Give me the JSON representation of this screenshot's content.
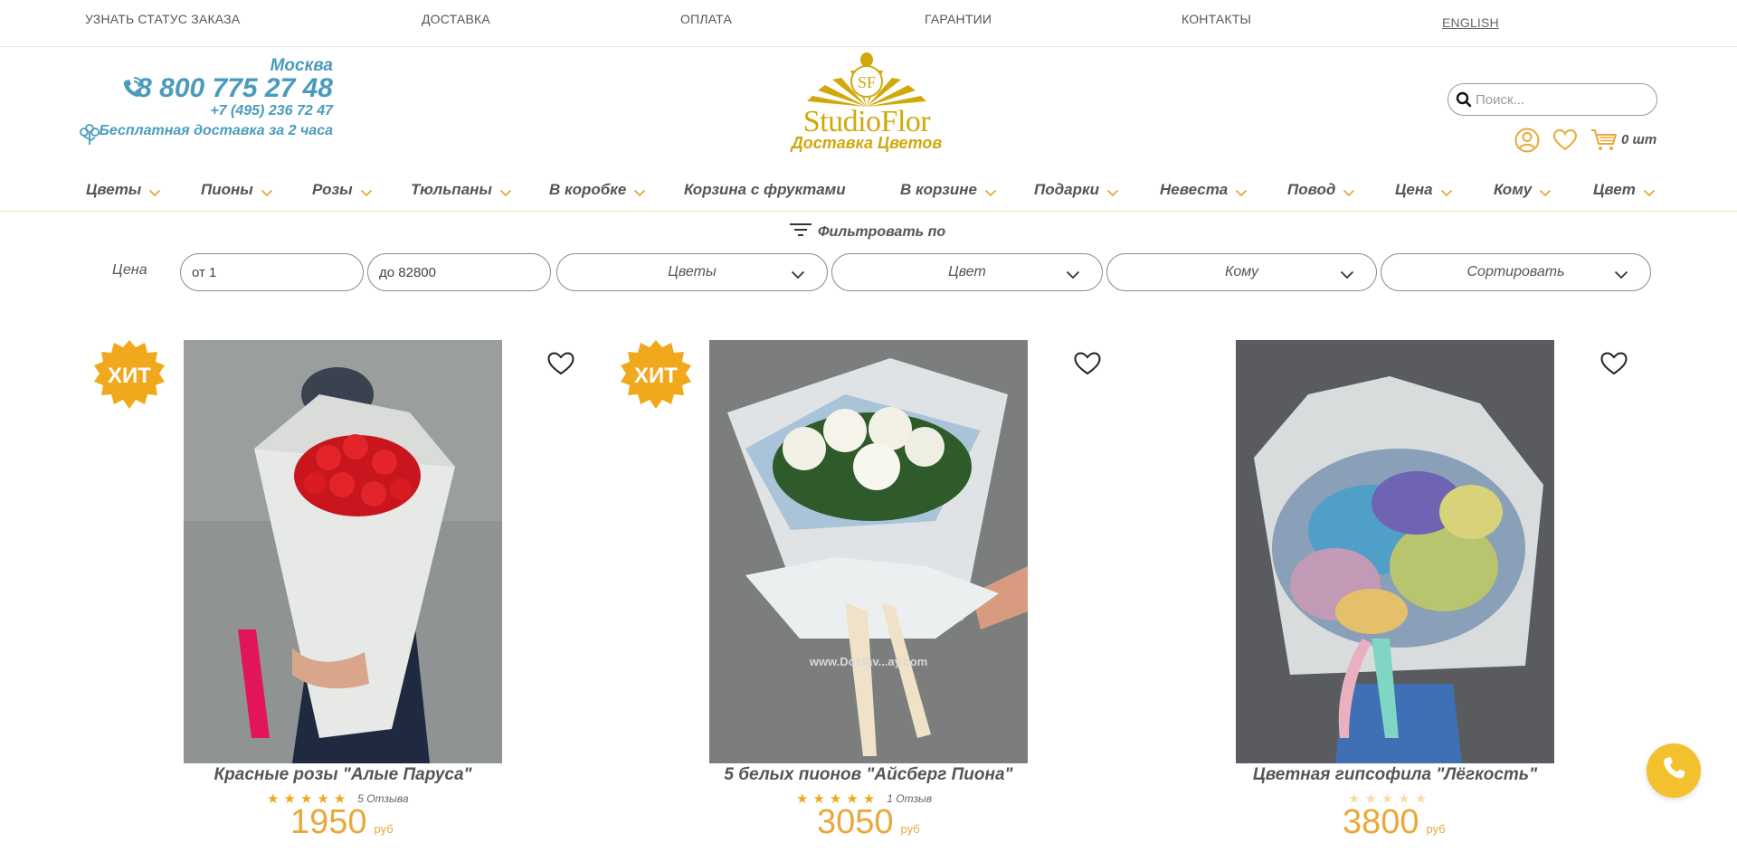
{
  "top_links": [
    {
      "label": "УЗНАТЬ СТАТУС ЗАКАЗА"
    },
    {
      "label": "ДОСТАВКА"
    },
    {
      "label": "ОПЛАТА"
    },
    {
      "label": "ГАРАНТИИ"
    },
    {
      "label": "КОНТАКТЫ"
    },
    {
      "label": "ENGLISH"
    }
  ],
  "contacts": {
    "city": "Москва",
    "phone_main": "8 800 775 27 48",
    "phone_second": "+7 (495) 236 72 47",
    "delivery": "Бесплатная доставка за 2 часа"
  },
  "logo": {
    "monogram": "SF",
    "name": "StudioFlor",
    "tagline": "Доставка Цветов"
  },
  "search": {
    "placeholder": "Поиск..."
  },
  "cart": {
    "count": "0 шт"
  },
  "nav": [
    {
      "label": "Цветы"
    },
    {
      "label": "Пионы"
    },
    {
      "label": "Розы"
    },
    {
      "label": "Тюльпаны"
    },
    {
      "label": "В коробке"
    },
    {
      "label": "Корзина с фруктами"
    },
    {
      "label": "В корзине"
    },
    {
      "label": "Подарки"
    },
    {
      "label": "Невеста"
    },
    {
      "label": "Повод"
    },
    {
      "label": "Цена"
    },
    {
      "label": "Кому"
    },
    {
      "label": "Цвет"
    }
  ],
  "filter": {
    "title": "Фильтровать по",
    "price_label": "Цена",
    "price_from": "от 1",
    "price_to": "до 82800",
    "selects": [
      {
        "label": "Цветы"
      },
      {
        "label": "Цвет"
      },
      {
        "label": "Кому"
      },
      {
        "label": "Сортировать"
      }
    ]
  },
  "products": [
    {
      "badge": "ХИТ",
      "name": "Красные розы \"Алые Паруса\"",
      "rating": 5,
      "reviews": "5 Отзыва",
      "price": "1950",
      "currency": "руб"
    },
    {
      "badge": "ХИТ",
      "name": "5 белых пионов \"Айсберг Пиона\"",
      "rating": 5,
      "reviews": "1 Отзыв",
      "price": "3050",
      "currency": "руб",
      "watermark": "www.Dostav...ay.com"
    },
    {
      "badge": "",
      "name": "Цветная гипсофила \"Лёгкость\"",
      "rating": 0,
      "reviews": "",
      "price": "3800",
      "currency": "руб"
    }
  ],
  "colors": {
    "accent": "#e8a93a",
    "brand_blue": "#4a9bbd",
    "logo_gold": "#d1a80a",
    "badge": "#f0a81c",
    "call": "#f3c02e"
  }
}
